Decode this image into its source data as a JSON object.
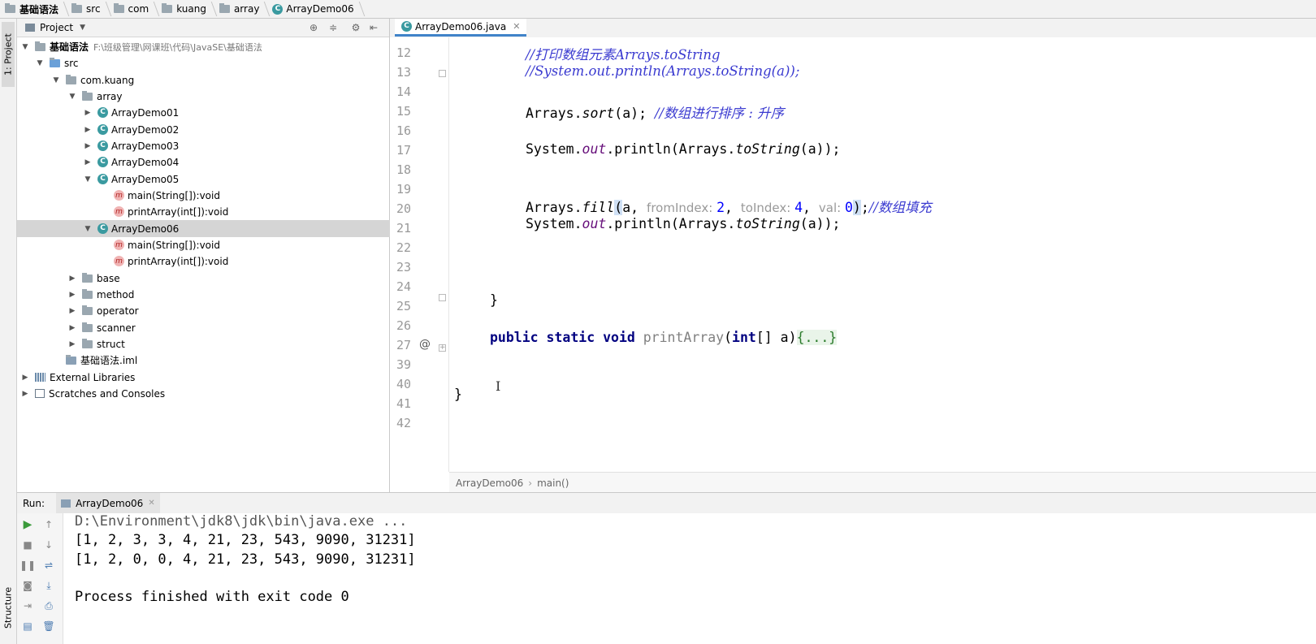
{
  "breadcrumbs": [
    "基础语法",
    "src",
    "com",
    "kuang",
    "array",
    "ArrayDemo06"
  ],
  "side_tabs": {
    "project": "1: Project",
    "structure": "Structure"
  },
  "project_panel": {
    "title": "Project",
    "root": {
      "name": "基础语法",
      "path": "F:\\班级管理\\网课班\\代码\\JavaSE\\基础语法"
    },
    "src": "src",
    "package": "com.kuang",
    "array_folder": "array",
    "classes": [
      "ArrayDemo01",
      "ArrayDemo02",
      "ArrayDemo03",
      "ArrayDemo04",
      "ArrayDemo05"
    ],
    "demo05_methods": [
      "main(String[]):void",
      "printArray(int[]):void"
    ],
    "selected_class": "ArrayDemo06",
    "demo06_methods": [
      "main(String[]):void",
      "printArray(int[]):void"
    ],
    "folders": [
      "base",
      "method",
      "operator",
      "scanner",
      "struct"
    ],
    "iml": "基础语法.iml",
    "external": "External Libraries",
    "scratches": "Scratches and Consoles"
  },
  "editor": {
    "tab": "ArrayDemo06.java",
    "line_numbers": [
      "12",
      "13",
      "14",
      "15",
      "16",
      "17",
      "18",
      "19",
      "20",
      "21",
      "22",
      "23",
      "24",
      "25",
      "26",
      "27",
      "39",
      "40",
      "41",
      "42"
    ],
    "code": {
      "l12": "//打印数组元素Arrays.toString",
      "l13": "//System.out.println(Arrays.toString(a));",
      "l15_code": "Arrays.",
      "l15_method": "sort",
      "l15_rest": "(a); ",
      "l15_comment": "//数组进行排序 : 升序",
      "sysout_a": "System.",
      "sysout_out": "out",
      "sysout_b": ".println(Arrays.",
      "sysout_tostr": "toString",
      "sysout_c": "(a));",
      "l20_a": "Arrays.",
      "l20_fill": "fill",
      "l20_paren": "(",
      "l20_a2": "a, ",
      "hint_from": "fromIndex: ",
      "val_from": "2",
      "sep": ", ",
      "hint_to": "toIndex: ",
      "val_to": "4",
      "hint_val": "val: ",
      "val_val": "0",
      "l20_close": ")",
      "l20_semi": ";",
      "l20_comment": "//数组填充",
      "brace": "}",
      "l27_kw": "public static void ",
      "l27_name": "printArray",
      "l27_a": "(",
      "l27_int": "int",
      "l27_b": "[] a)",
      "l27_fold": "{...}"
    },
    "status_crumbs": [
      "ArrayDemo06",
      "main()"
    ]
  },
  "run": {
    "label": "Run:",
    "tab": "ArrayDemo06",
    "output": [
      "D:\\Environment\\jdk8\\jdk\\bin\\java.exe ...",
      "[1, 2, 3, 3, 4, 21, 23, 543, 9090, 31231]",
      "[1, 2, 0, 0, 4, 21, 23, 543, 9090, 31231]",
      "Process finished with exit code 0"
    ]
  }
}
